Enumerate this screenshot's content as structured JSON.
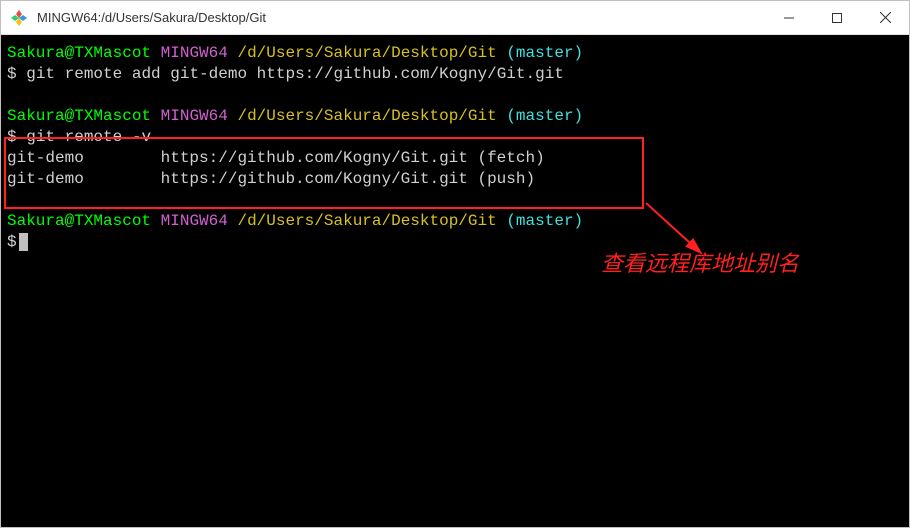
{
  "titlebar": {
    "title": "MINGW64:/d/Users/Sakura/Desktop/Git"
  },
  "prompt": {
    "user_host": "Sakura@TXMascot",
    "env": "MINGW64",
    "path": "/d/Users/Sakura/Desktop/Git",
    "branch": "(master)",
    "symbol": "$"
  },
  "blocks": [
    {
      "command": "git remote add git-demo https://github.com/Kogny/Git.git",
      "output": []
    },
    {
      "command": "git remote -v",
      "output": [
        "git-demo        https://github.com/Kogny/Git.git (fetch)",
        "git-demo        https://github.com/Kogny/Git.git (push)"
      ]
    },
    {
      "command": "",
      "output": []
    }
  ],
  "annotation": "查看远程库地址别名"
}
